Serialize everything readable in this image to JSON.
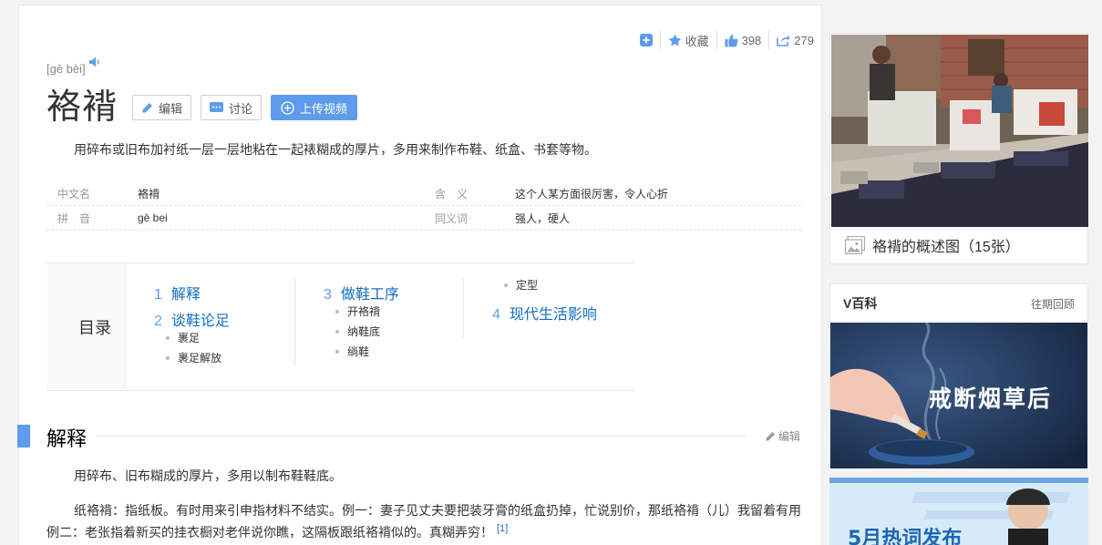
{
  "toolbar": {
    "collect_label": "收藏",
    "like_count": "398",
    "share_count": "279"
  },
  "entry": {
    "pinyin": "[gē bèi]",
    "title": "袼褙",
    "edit_label": "编辑",
    "discuss_label": "讨论",
    "upload_video_label": "上传视频",
    "summary": "用碎布或旧布加衬纸一层一层地粘在一起裱糊成的厚片，多用来制作布鞋、纸盒、书套等物。"
  },
  "basic_info": [
    {
      "name": "中文名",
      "value": "袼褙",
      "name2": "含　义",
      "value2": "这个人某方面很厉害，令人心折"
    },
    {
      "name": "拼　音",
      "value": "gē bei",
      "name2": "同义词",
      "value2": "强人，硬人"
    }
  ],
  "catalog": {
    "label": "目录",
    "items": [
      {
        "num": "1",
        "label": "解释"
      },
      {
        "num": "2",
        "label": "谈鞋论足"
      },
      {
        "num": "3",
        "label": "做鞋工序"
      },
      {
        "num": "4",
        "label": "现代生活影响"
      }
    ],
    "subs": {
      "s2a": "裹足",
      "s2b": "裹足解放",
      "s3a": "开袼褙",
      "s3b": "纳鞋底",
      "s3c": "绱鞋",
      "s3d": "定型"
    }
  },
  "section": {
    "title": "解释",
    "edit_label": "编辑",
    "p1": "用碎布、旧布糊成的厚片，多用以制布鞋鞋底。",
    "p2": "纸袼褙：指纸板。有时用来引申指材料不结实。例一：妻子见丈夫要把装牙膏的纸盒扔掉，忙说别价，那纸袼褙（儿）我留着有用例二：老张指着新买的挂衣橱对老伴说你瞧，这隔板跟纸袼褙似的。真糊弄穷！",
    "ref": "[1]"
  },
  "sidebar": {
    "image_caption": "袼褙的概述图（15张）",
    "vbaike_title": "V百科",
    "vbaike_more": "往期回顾",
    "banner_text": "戒断烟草后",
    "hot_text": "5月热词发布"
  },
  "colors": {
    "accent": "#5d9cec",
    "link": "#136ec2"
  }
}
